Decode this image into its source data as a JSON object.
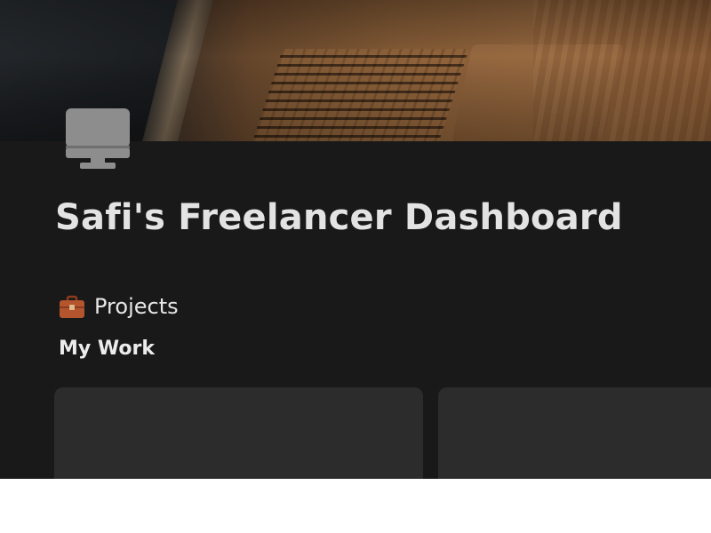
{
  "page": {
    "title": "Safi's Freelancer Dashboard",
    "icon": "desktop-computer-icon"
  },
  "cover": {
    "image": "laptop-on-wooden-desk-photo"
  },
  "projects_section": {
    "icon": "briefcase-icon",
    "heading": "Projects",
    "view_label": "My Work",
    "cards": [
      {
        "title": ""
      },
      {
        "title": ""
      }
    ]
  },
  "colors": {
    "background": "#191919",
    "card": "#2c2c2c",
    "title_text": "#e3e3e3",
    "briefcase": "#b4552e"
  }
}
